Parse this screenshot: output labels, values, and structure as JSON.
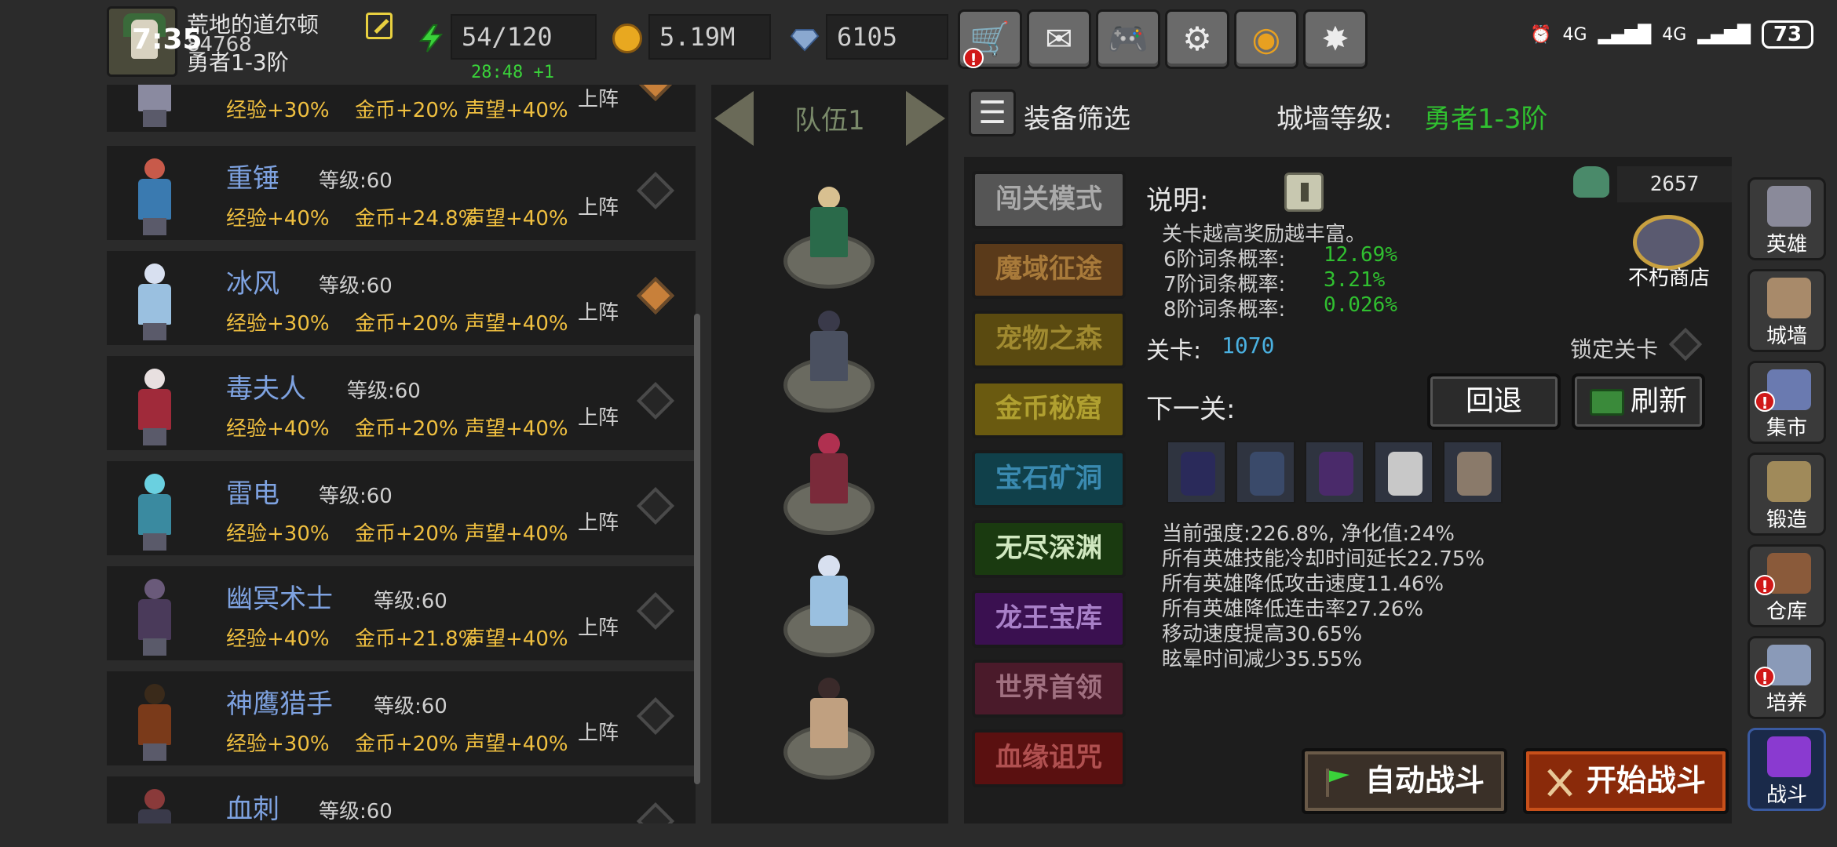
{
  "player": {
    "name": "荒地的道尔顿",
    "id": "84768",
    "rank": "勇者1-3阶",
    "clock": "7:35"
  },
  "resources": {
    "energy": "54/120",
    "gold": "5.19M",
    "gems": "6105",
    "timer": "28:48 +1"
  },
  "top_buttons": [
    {
      "name": "shop",
      "glyph": "🛒",
      "alert": "!"
    },
    {
      "name": "mail",
      "glyph": "✉"
    },
    {
      "name": "gamepad",
      "glyph": "🎮"
    },
    {
      "name": "settings",
      "glyph": "⚙"
    },
    {
      "name": "palette",
      "glyph": "◉"
    },
    {
      "name": "firework",
      "glyph": "✸"
    }
  ],
  "status_bar": {
    "signal1": "4G",
    "signal2": "4G",
    "battery": "73"
  },
  "heroes": [
    {
      "name": "",
      "level_label": "",
      "exp": "经验+30%",
      "gold": "金币+20%",
      "fame": "声望+40%",
      "deploy": "上阵",
      "active": true,
      "color_body": "#8a8aa0",
      "color_head": "#d8b090"
    },
    {
      "name": "重锤",
      "level_label": "等级:60",
      "exp": "经验+40%",
      "gold": "金币+24.8%",
      "fame": "声望+40%",
      "deploy": "上阵",
      "active": false,
      "color_body": "#3a7ab0",
      "color_head": "#c85a4a"
    },
    {
      "name": "冰风",
      "level_label": "等级:60",
      "exp": "经验+30%",
      "gold": "金币+20%",
      "fame": "声望+40%",
      "deploy": "上阵",
      "active": true,
      "color_body": "#9ac0e0",
      "color_head": "#d8e0f0"
    },
    {
      "name": "毒夫人",
      "level_label": "等级:60",
      "exp": "经验+40%",
      "gold": "金币+20%",
      "fame": "声望+40%",
      "deploy": "上阵",
      "active": false,
      "color_body": "#a02a3a",
      "color_head": "#e8e0e0"
    },
    {
      "name": "雷电",
      "level_label": "等级:60",
      "exp": "经验+30%",
      "gold": "金币+20%",
      "fame": "声望+40%",
      "deploy": "上阵",
      "active": false,
      "color_body": "#3a8aa0",
      "color_head": "#6ad0e0"
    },
    {
      "name": "幽冥术士",
      "level_label": "等级:60",
      "exp": "经验+40%",
      "gold": "金币+21.8%",
      "fame": "声望+40%",
      "deploy": "上阵",
      "active": false,
      "color_body": "#4a3a5a",
      "color_head": "#6a5a7a"
    },
    {
      "name": "神鹰猎手",
      "level_label": "等级:60",
      "exp": "经验+30%",
      "gold": "金币+20%",
      "fame": "声望+40%",
      "deploy": "上阵",
      "active": false,
      "color_body": "#7a3a1a",
      "color_head": "#3a2a1a"
    },
    {
      "name": "血刺",
      "level_label": "等级:60",
      "exp": "",
      "gold": "",
      "fame": "",
      "deploy": "",
      "active": false,
      "color_body": "#3a3a4a",
      "color_head": "#8a3a3a"
    }
  ],
  "team": {
    "label": "队伍1",
    "members": [
      {
        "head": "#d8c090",
        "body": "#2a6a4a"
      },
      {
        "head": "#3a3a4a",
        "body": "#4a5060"
      },
      {
        "head": "#b03050",
        "body": "#7a2a3a"
      },
      {
        "head": "#d8e0f0",
        "body": "#9ac0e0"
      },
      {
        "head": "#3a2a2a",
        "body": "#c0a080"
      }
    ]
  },
  "header": {
    "filter_glyph": "☰",
    "filter_label": "装备筛选",
    "wall_label": "城墙等级:",
    "wall_value": "勇者1-3阶"
  },
  "modes": [
    {
      "label": "闯关模式",
      "bg": "#555555",
      "fg": "#aaaaaa"
    },
    {
      "label": "魔域征途",
      "bg": "#5a3a1a",
      "fg": "#a87a3a"
    },
    {
      "label": "宠物之森",
      "bg": "#5a4a10",
      "fg": "#a08a30"
    },
    {
      "label": "金币秘窟",
      "bg": "#6a5a10",
      "fg": "#b0a030"
    },
    {
      "label": "宝石矿洞",
      "bg": "#10404a",
      "fg": "#3a8ab0"
    },
    {
      "label": "无尽深渊",
      "bg": "#1a3a10",
      "fg": "#d0e8c0"
    },
    {
      "label": "龙王宝库",
      "bg": "#3a1050",
      "fg": "#a880c8"
    },
    {
      "label": "世界首领",
      "bg": "#4a1a2a",
      "fg": "#a07080"
    },
    {
      "label": "血缘诅咒",
      "bg": "#5a1010",
      "fg": "#b05050"
    }
  ],
  "info": {
    "label": "说明:",
    "desc": "关卡越高奖励越丰富。",
    "rates": [
      {
        "label": "6阶词条概率:",
        "value": "12.69%"
      },
      {
        "label": "7阶词条概率:",
        "value": "3.21%"
      },
      {
        "label": "8阶词条概率:",
        "value": "0.026%"
      }
    ],
    "token_value": "2657",
    "shop_label": "不朽商店",
    "stage_label": "关卡:",
    "stage_value": "1070",
    "lock_label": "锁定关卡",
    "next_label": "下一关:",
    "back_button": "回退",
    "refresh_button": "刷新"
  },
  "enemies": [
    {
      "color": "#2a2a5a"
    },
    {
      "color": "#3a4a6a"
    },
    {
      "color": "#4a2a6a"
    },
    {
      "color": "#c8c8c8"
    },
    {
      "color": "#8a7a6a"
    }
  ],
  "stats": [
    "当前强度:226.8%, 净化值:24%",
    "所有英雄技能冷却时间延长22.75%",
    "所有英雄降低攻击速度11.46%",
    "所有英雄降低连击率27.26%",
    "移动速度提高30.65%",
    "眩晕时间减少35.55%"
  ],
  "battle": {
    "auto_label": "自动战斗",
    "start_label": "开始战斗"
  },
  "side_nav": [
    {
      "label": "英雄",
      "color": "#8a8a9a",
      "alert": false
    },
    {
      "label": "城墙",
      "color": "#a88a6a",
      "alert": false
    },
    {
      "label": "集市",
      "color": "#6a7ab0",
      "alert": true
    },
    {
      "label": "锻造",
      "color": "#a08a5a",
      "alert": false
    },
    {
      "label": "仓库",
      "color": "#8a5a3a",
      "alert": true
    },
    {
      "label": "培养",
      "color": "#8a9ab8",
      "alert": true
    },
    {
      "label": "战斗",
      "color": "#8a3ad0",
      "alert": false
    }
  ]
}
